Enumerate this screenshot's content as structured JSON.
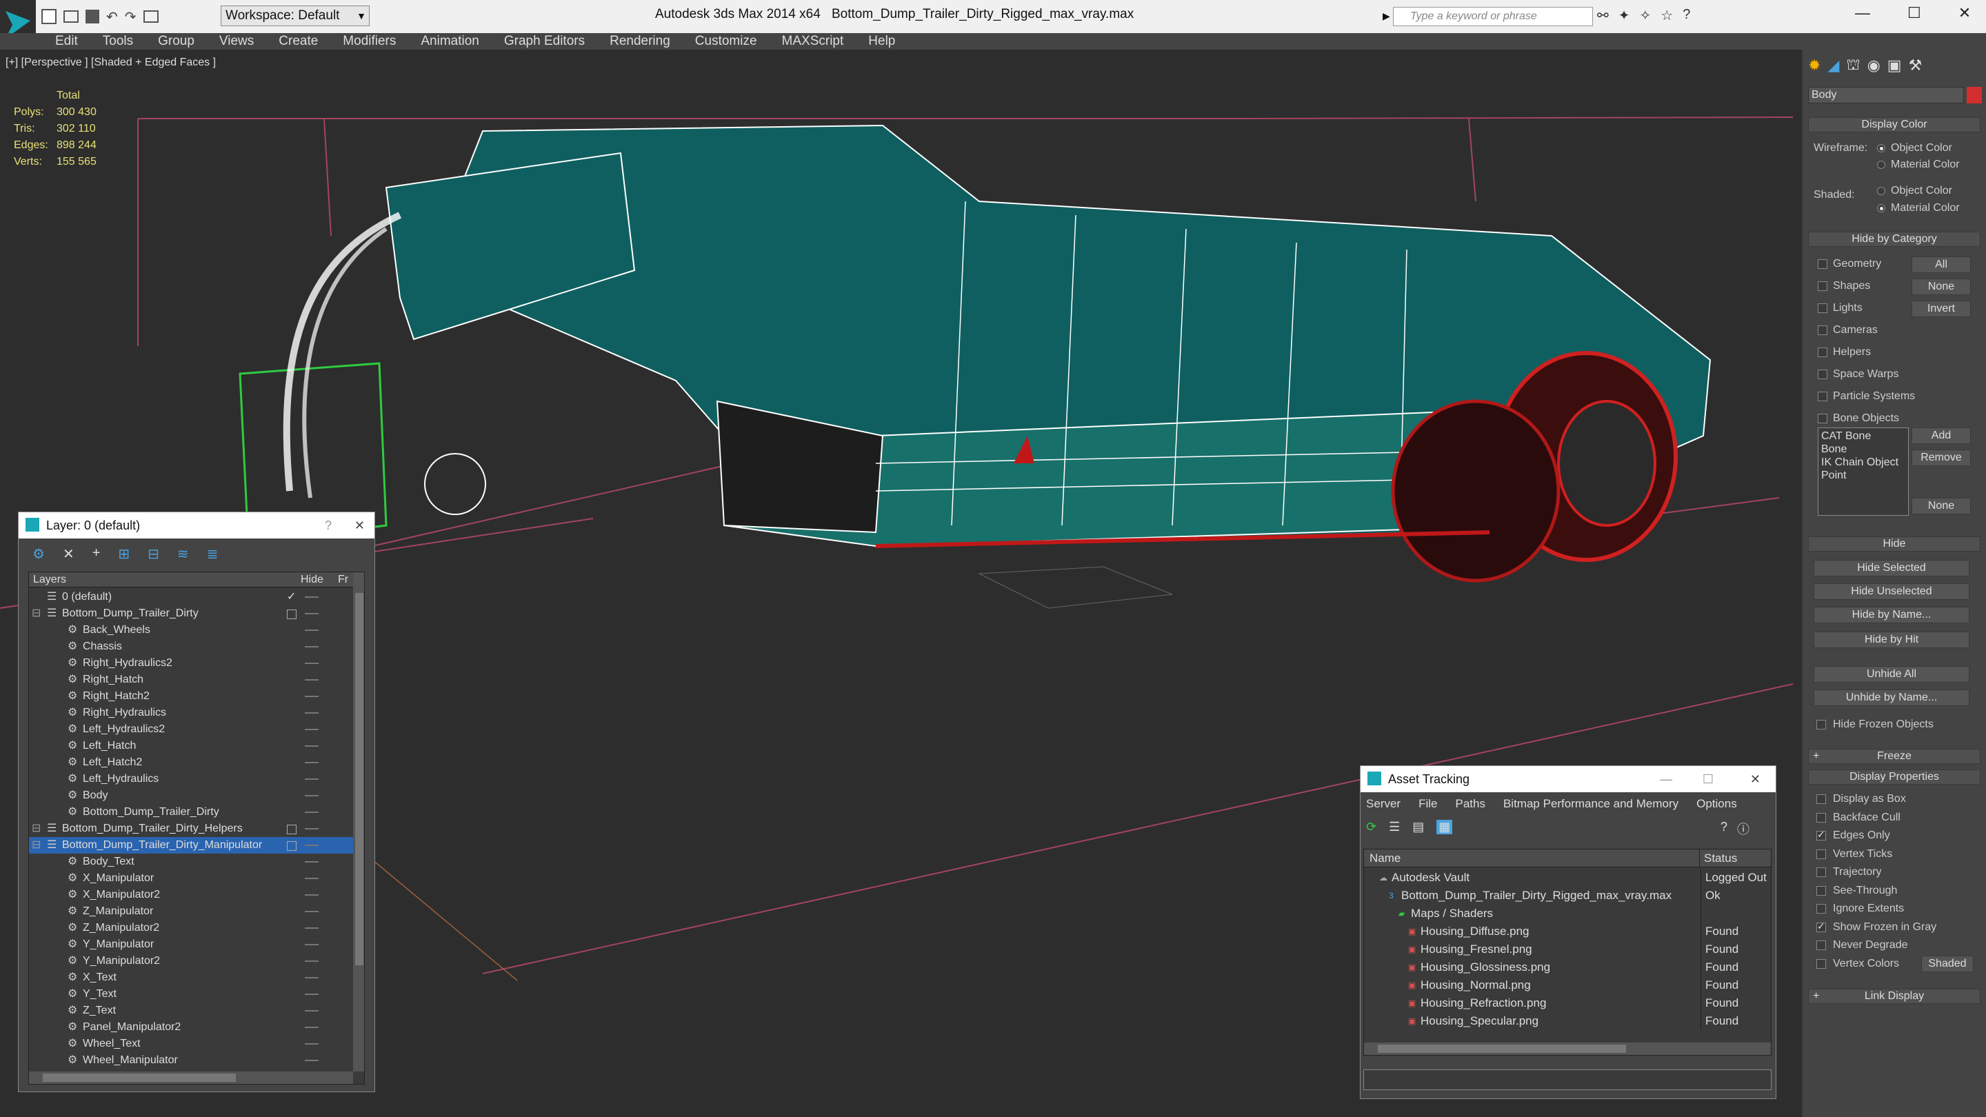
{
  "app": {
    "title": "Autodesk 3ds Max  2014 x64",
    "file": "Bottom_Dump_Trailer_Dirty_Rigged_max_vray.max",
    "workspace": "Workspace: Default",
    "search_placeholder": "Type a keyword or phrase"
  },
  "menu": [
    "Edit",
    "Tools",
    "Group",
    "Views",
    "Create",
    "Modifiers",
    "Animation",
    "Graph Editors",
    "Rendering",
    "Customize",
    "MAXScript",
    "Help"
  ],
  "viewport": {
    "label": "[+] [Perspective ] [Shaded + Edged Faces ]",
    "stats_header": "Total",
    "stats": [
      {
        "label": "Polys:",
        "value": "300 430"
      },
      {
        "label": "Tris:",
        "value": "302 110"
      },
      {
        "label": "Edges:",
        "value": "898 244"
      },
      {
        "label": "Verts:",
        "value": "155 565"
      }
    ]
  },
  "command_panel": {
    "object_name": "Body",
    "colors": {
      "object": "#d32f2f"
    },
    "display_color": {
      "title": "Display Color",
      "wireframe_label": "Wireframe:",
      "shaded_label": "Shaded:",
      "object_color": "Object Color",
      "material_color": "Material Color"
    },
    "hide_by_category": {
      "title": "Hide by Category",
      "items": [
        "Geometry",
        "Shapes",
        "Lights",
        "Cameras",
        "Helpers",
        "Space Warps",
        "Particle Systems",
        "Bone Objects"
      ],
      "buttons": [
        "All",
        "None",
        "Invert"
      ],
      "list": [
        "CAT Bone",
        "Bone",
        "IK Chain Object",
        "Point"
      ],
      "add": "Add",
      "remove": "Remove",
      "none": "None"
    },
    "hide": {
      "title": "Hide",
      "buttons": [
        "Hide Selected",
        "Hide Unselected",
        "Hide by Name...",
        "Hide by Hit"
      ],
      "unhide": [
        "Unhide All",
        "Unhide by Name..."
      ],
      "frozen": "Hide Frozen Objects"
    },
    "freeze": "Freeze",
    "display_properties": {
      "title": "Display Properties",
      "items": [
        {
          "label": "Display as Box",
          "checked": false
        },
        {
          "label": "Backface Cull",
          "checked": false
        },
        {
          "label": "Edges Only",
          "checked": true
        },
        {
          "label": "Vertex Ticks",
          "checked": false
        },
        {
          "label": "Trajectory",
          "checked": false
        },
        {
          "label": "See-Through",
          "checked": false
        },
        {
          "label": "Ignore Extents",
          "checked": false
        },
        {
          "label": "Show Frozen in Gray",
          "checked": true
        },
        {
          "label": "Never Degrade",
          "checked": false
        },
        {
          "label": "Vertex Colors",
          "checked": false
        }
      ],
      "shaded_btn": "Shaded"
    },
    "link_display": "Link Display"
  },
  "layer_window": {
    "title": "Layer: 0 (default)",
    "col_layers": "Layers",
    "col_hide": "Hide",
    "col_fr": "Fr",
    "rows": [
      {
        "name": "0 (default)",
        "indent": 1,
        "type": "layer"
      },
      {
        "name": "Bottom_Dump_Trailer_Dirty",
        "indent": 1,
        "type": "layer"
      },
      {
        "name": "Back_Wheels",
        "indent": 2,
        "type": "obj"
      },
      {
        "name": "Chassis",
        "indent": 2,
        "type": "obj"
      },
      {
        "name": "Right_Hydraulics2",
        "indent": 2,
        "type": "obj"
      },
      {
        "name": "Right_Hatch",
        "indent": 2,
        "type": "obj"
      },
      {
        "name": "Right_Hatch2",
        "indent": 2,
        "type": "obj"
      },
      {
        "name": "Right_Hydraulics",
        "indent": 2,
        "type": "obj"
      },
      {
        "name": "Left_Hydraulics2",
        "indent": 2,
        "type": "obj"
      },
      {
        "name": "Left_Hatch",
        "indent": 2,
        "type": "obj"
      },
      {
        "name": "Left_Hatch2",
        "indent": 2,
        "type": "obj"
      },
      {
        "name": "Left_Hydraulics",
        "indent": 2,
        "type": "obj"
      },
      {
        "name": "Body",
        "indent": 2,
        "type": "obj"
      },
      {
        "name": "Bottom_Dump_Trailer_Dirty",
        "indent": 2,
        "type": "obj"
      },
      {
        "name": "Bottom_Dump_Trailer_Dirty_Helpers",
        "indent": 1,
        "type": "layer"
      },
      {
        "name": "Bottom_Dump_Trailer_Dirty_Manipulator",
        "indent": 1,
        "type": "layer",
        "selected": true
      },
      {
        "name": "Body_Text",
        "indent": 2,
        "type": "obj"
      },
      {
        "name": "X_Manipulator",
        "indent": 2,
        "type": "obj"
      },
      {
        "name": "X_Manipulator2",
        "indent": 2,
        "type": "obj"
      },
      {
        "name": "Z_Manipulator",
        "indent": 2,
        "type": "obj"
      },
      {
        "name": "Z_Manipulator2",
        "indent": 2,
        "type": "obj"
      },
      {
        "name": "Y_Manipulator",
        "indent": 2,
        "type": "obj"
      },
      {
        "name": "Y_Manipulator2",
        "indent": 2,
        "type": "obj"
      },
      {
        "name": "X_Text",
        "indent": 2,
        "type": "obj"
      },
      {
        "name": "Y_Text",
        "indent": 2,
        "type": "obj"
      },
      {
        "name": "Z_Text",
        "indent": 2,
        "type": "obj"
      },
      {
        "name": "Panel_Manipulator2",
        "indent": 2,
        "type": "obj"
      },
      {
        "name": "Wheel_Text",
        "indent": 2,
        "type": "obj"
      },
      {
        "name": "Wheel_Manipulator",
        "indent": 2,
        "type": "obj"
      }
    ]
  },
  "asset_window": {
    "title": "Asset Tracking",
    "menu": [
      "Server",
      "File",
      "Paths",
      "Bitmap Performance and Memory",
      "Options"
    ],
    "col_name": "Name",
    "col_status": "Status",
    "rows": [
      {
        "name": "Autodesk Vault",
        "status": "Logged Out",
        "indent": 0,
        "kind": "vault"
      },
      {
        "name": "Bottom_Dump_Trailer_Dirty_Rigged_max_vray.max",
        "status": "Ok",
        "indent": 1,
        "kind": "max"
      },
      {
        "name": "Maps / Shaders",
        "status": "",
        "indent": 2,
        "kind": "folder"
      },
      {
        "name": "Housing_Diffuse.png",
        "status": "Found",
        "indent": 3,
        "kind": "png"
      },
      {
        "name": "Housing_Fresnel.png",
        "status": "Found",
        "indent": 3,
        "kind": "png"
      },
      {
        "name": "Housing_Glossiness.png",
        "status": "Found",
        "indent": 3,
        "kind": "png"
      },
      {
        "name": "Housing_Normal.png",
        "status": "Found",
        "indent": 3,
        "kind": "png"
      },
      {
        "name": "Housing_Refraction.png",
        "status": "Found",
        "indent": 3,
        "kind": "png"
      },
      {
        "name": "Housing_Specular.png",
        "status": "Found",
        "indent": 3,
        "kind": "png"
      }
    ]
  }
}
